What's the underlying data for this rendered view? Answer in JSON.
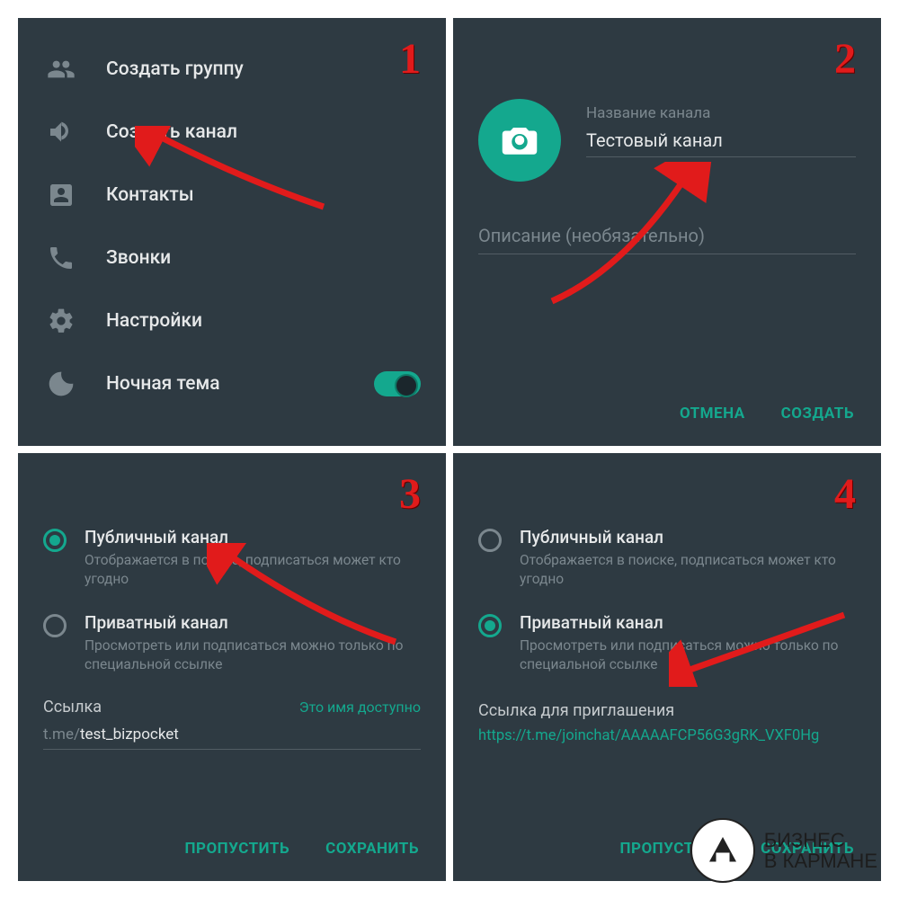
{
  "steps": [
    "1",
    "2",
    "3",
    "4"
  ],
  "panel1": {
    "menu": [
      {
        "icon": "group",
        "label": "Создать группу"
      },
      {
        "icon": "megaphone",
        "label": "Создать канал"
      },
      {
        "icon": "contact",
        "label": "Контакты"
      },
      {
        "icon": "phone",
        "label": "Звонки"
      },
      {
        "icon": "gear",
        "label": "Настройки"
      },
      {
        "icon": "moon",
        "label": "Ночная тема"
      }
    ]
  },
  "panel2": {
    "name_label": "Название канала",
    "name_value": "Тестовый канал",
    "desc_placeholder": "Описание (необязательно)",
    "cancel": "ОТМЕНА",
    "create": "СОЗДАТЬ"
  },
  "panel3": {
    "public_title": "Публичный канал",
    "public_desc": "Отображается в поиске, подписаться может кто угодно",
    "private_title": "Приватный канал",
    "private_desc": "Просмотреть или подписаться можно только по специальной ссылке",
    "selected": "public",
    "link_label": "Ссылка",
    "link_available": "Это имя доступно",
    "link_prefix": "t.me/",
    "link_value": "test_bizpocket",
    "skip": "ПРОПУСТИТЬ",
    "save": "СОХРАНИТЬ"
  },
  "panel4": {
    "public_title": "Публичный канал",
    "public_desc": "Отображается в поиске, подписаться может кто угодно",
    "private_title": "Приватный канал",
    "private_desc": "Просмотреть или подписаться можно только по специальной ссылке",
    "selected": "private",
    "invite_label": "Ссылка для приглашения",
    "invite_link": "https://t.me/joinchat/AAAAAFCP56G3gRK_VXF0Hg",
    "skip": "ПРОПУСТИТЬ",
    "save": "СОХРАНИТЬ"
  },
  "watermark": {
    "line1": "БИЗНЕС",
    "line2": "В КАРМАНЕ"
  },
  "colors": {
    "accent": "#14a88e",
    "bg": "#2e3a42",
    "muted": "#7b878e",
    "arrow": "#e11b1b"
  }
}
